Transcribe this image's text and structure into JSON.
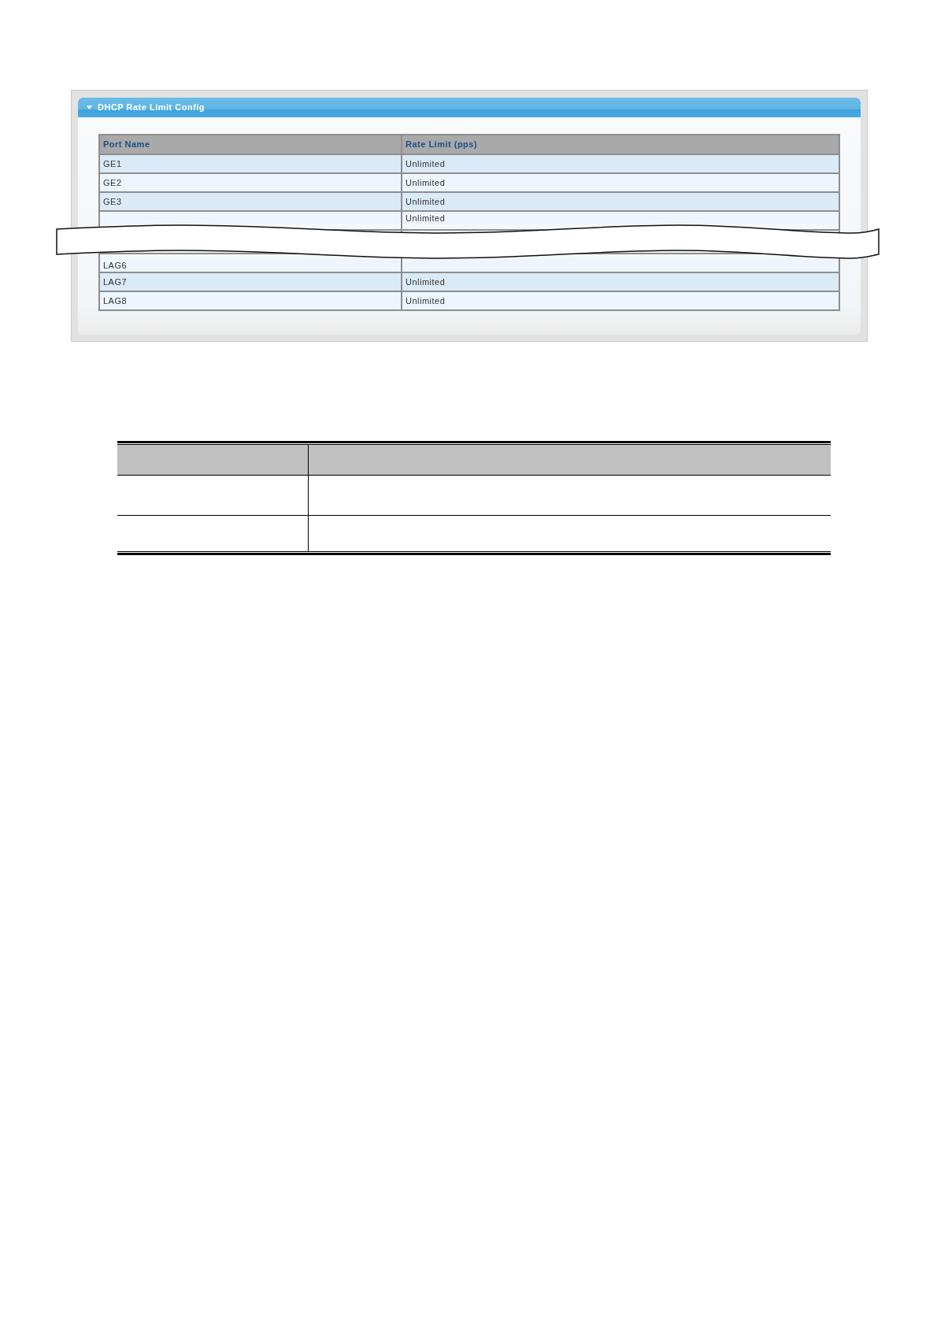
{
  "panel": {
    "title": "DHCP Rate Limit Config",
    "expanded": true
  },
  "table": {
    "columns": [
      "Port Name",
      "Rate Limit (pps)"
    ],
    "rows_before_break": [
      {
        "port_name": "GE1",
        "rate_limit": "Unlimited"
      },
      {
        "port_name": "GE2",
        "rate_limit": "Unlimited"
      },
      {
        "port_name": "GE3",
        "rate_limit": "Unlimited"
      },
      {
        "rate_limit": "Unlimited"
      }
    ],
    "rows_after_break": [
      {
        "port_name": "LAG6"
      },
      {
        "port_name": "LAG7",
        "rate_limit": "Unlimited"
      },
      {
        "port_name": "LAG8",
        "rate_limit": "Unlimited"
      }
    ]
  }
}
